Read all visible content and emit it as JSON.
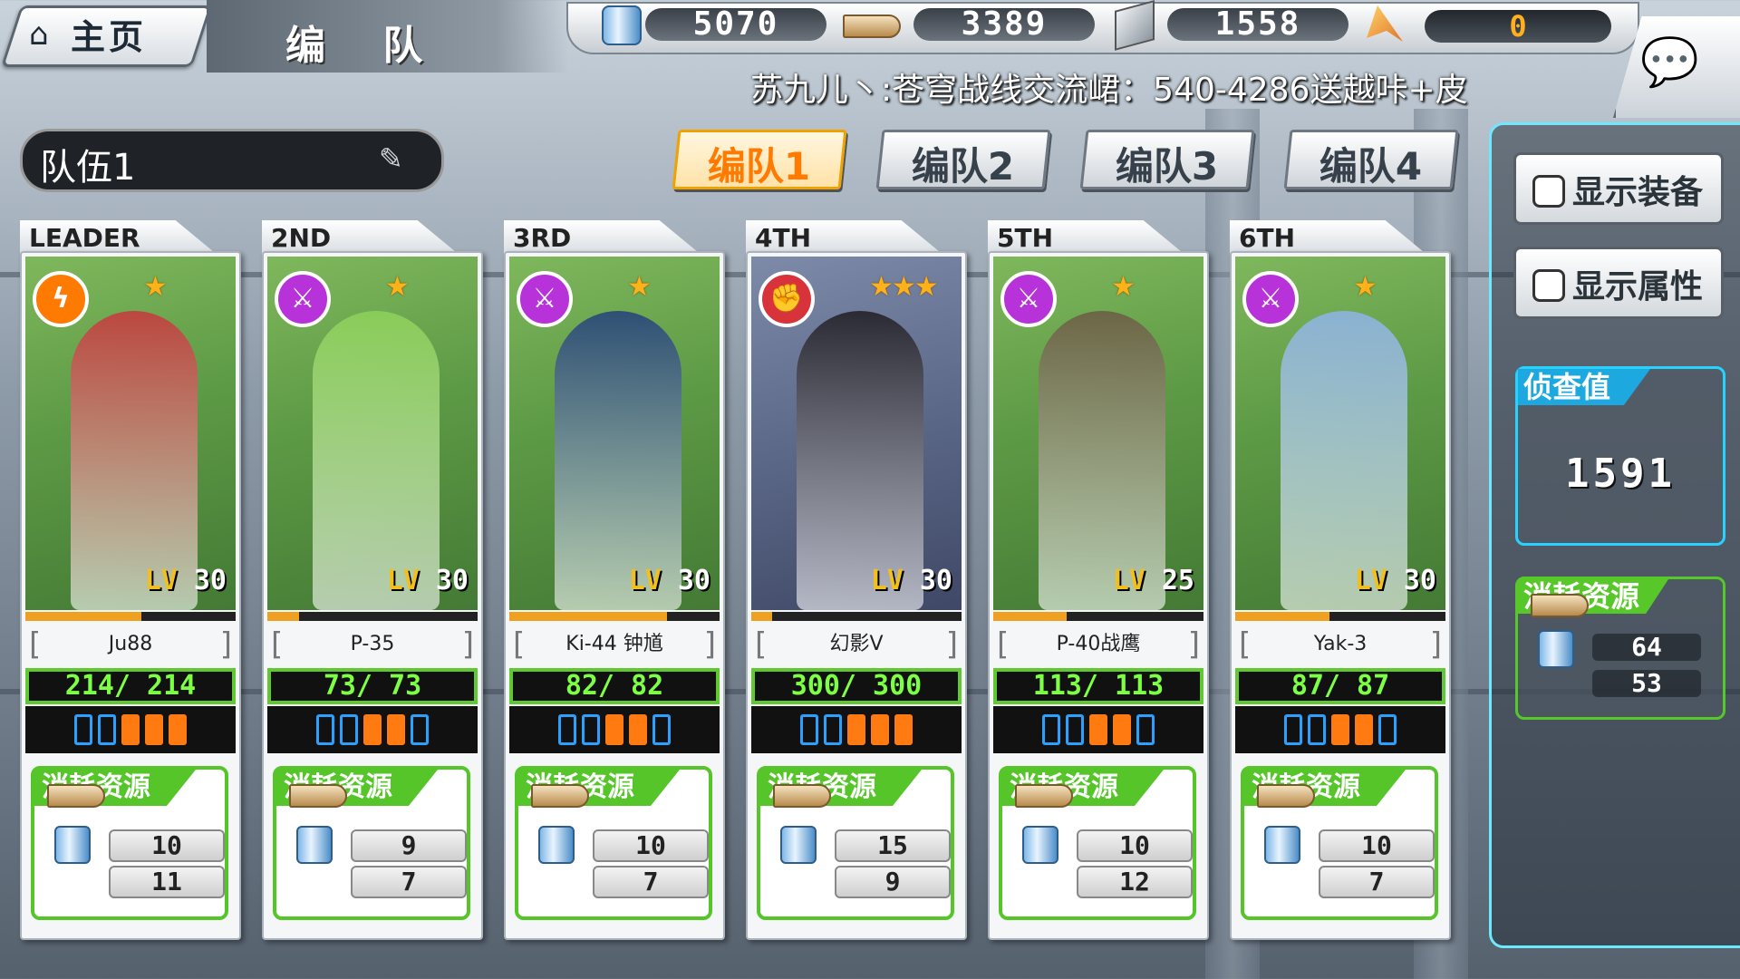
{
  "header": {
    "home_label": "主页",
    "title": "编 队",
    "announcement": "苏九儿丶:苍穹战线交流峮：540-4286送越咔+皮"
  },
  "resources": {
    "fuel": "5070",
    "ammo": "3389",
    "steel": "1558",
    "bauxite": "0"
  },
  "team": {
    "name": "队伍1",
    "tabs": [
      "编队1",
      "编队2",
      "编队3",
      "编队4"
    ],
    "active_tab": 0
  },
  "right_panel": {
    "show_equipment": "显示装备",
    "show_attributes": "显示属性",
    "scout_title": "侦查值",
    "scout_value": "1591",
    "total_cost_title": "消耗资源",
    "total_fuel": "64",
    "total_ammo": "53"
  },
  "cards": [
    {
      "rank": "LEADER",
      "name": "Ju88",
      "level": "30",
      "hp": "214/ 214",
      "stars": "★",
      "class_icon": "lightning-icon",
      "class_color": "#ff7a00",
      "exp": 0.55,
      "morale_on": 3,
      "cost_title": "消耗资源",
      "fuel": "10",
      "ammo": "11",
      "bg": "green",
      "figure_color": "#c8363c"
    },
    {
      "rank": "2ND",
      "name": "P-35",
      "level": "30",
      "hp": "73/ 73",
      "stars": "★",
      "class_icon": "crossed-swords-icon",
      "class_color": "#b733d9",
      "exp": 0.15,
      "morale_on": 2,
      "cost_title": "消耗资源",
      "fuel": "9",
      "ammo": "7",
      "bg": "green",
      "figure_color": "#8ed25a"
    },
    {
      "rank": "3RD",
      "name": "Ki-44 钟馗",
      "level": "30",
      "hp": "82/ 82",
      "stars": "★",
      "class_icon": "crossed-swords-icon",
      "class_color": "#b733d9",
      "exp": 0.75,
      "morale_on": 2,
      "cost_title": "消耗资源",
      "fuel": "10",
      "ammo": "7",
      "bg": "green",
      "figure_color": "#23407a"
    },
    {
      "rank": "4TH",
      "name": "幻影V",
      "level": "30",
      "hp": "300/ 300",
      "stars": "★★★",
      "class_icon": "fist-icon",
      "class_color": "#d8333b",
      "exp": 0.1,
      "morale_on": 3,
      "cost_title": "消耗资源",
      "fuel": "15",
      "ammo": "9",
      "bg": "blue",
      "figure_color": "#1f1c22"
    },
    {
      "rank": "5TH",
      "name": "P-40战鹰",
      "level": "25",
      "hp": "113/ 113",
      "stars": "★",
      "class_icon": "crossed-swords-icon",
      "class_color": "#b733d9",
      "exp": 0.35,
      "morale_on": 2,
      "cost_title": "消耗资源",
      "fuel": "10",
      "ammo": "12",
      "bg": "green",
      "figure_color": "#6b5a44"
    },
    {
      "rank": "6TH",
      "name": "Yak-3",
      "level": "30",
      "hp": "87/ 87",
      "stars": "★",
      "class_icon": "crossed-swords-icon",
      "class_color": "#b733d9",
      "exp": 0.45,
      "morale_on": 2,
      "cost_title": "消耗资源",
      "fuel": "10",
      "ammo": "7",
      "bg": "green",
      "figure_color": "#8fb3e8"
    }
  ]
}
